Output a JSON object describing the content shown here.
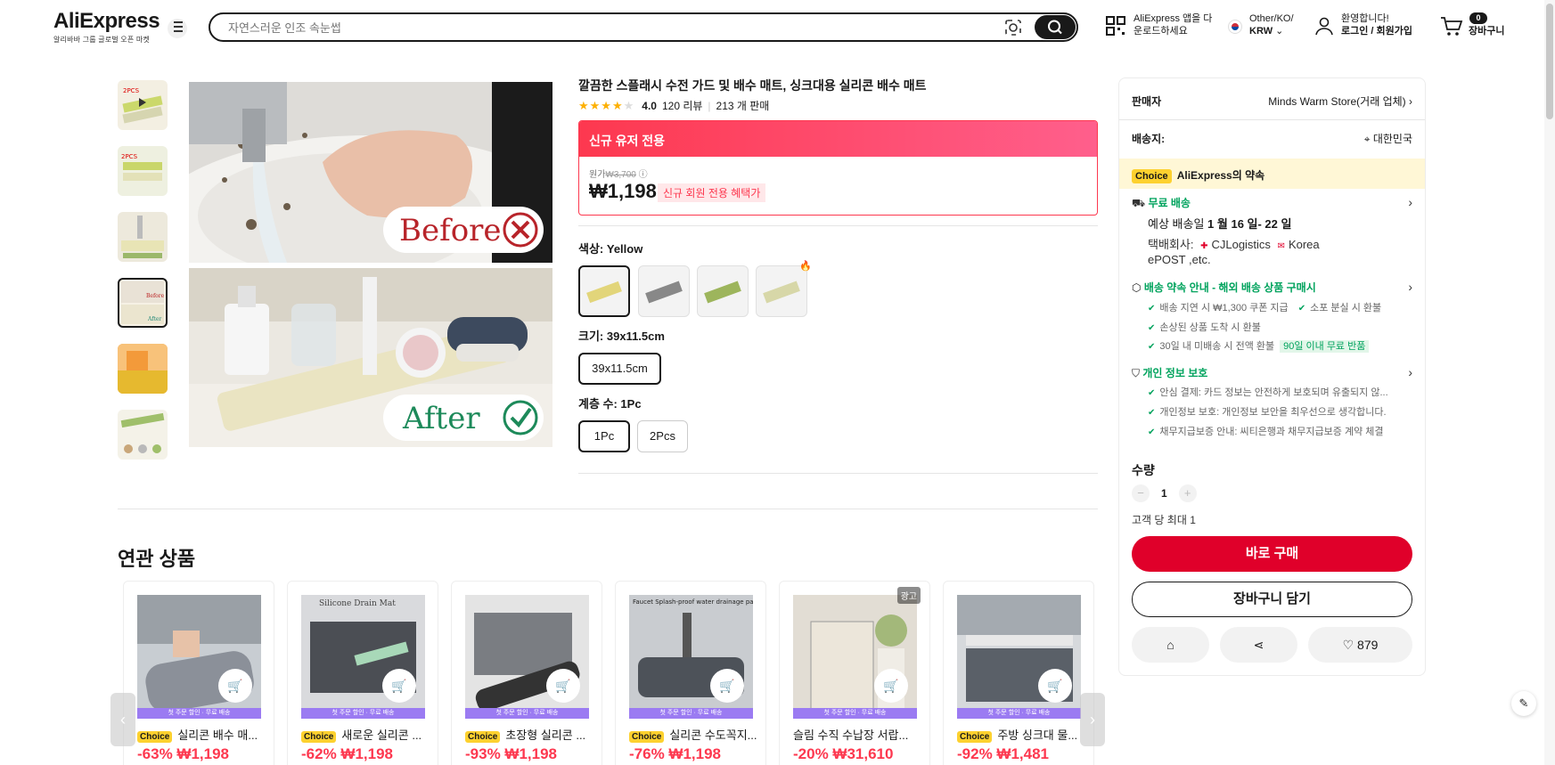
{
  "header": {
    "logo_text": "AliExpress",
    "logo_sub": "알리바바 그룹 글로벌 오픈 마켓",
    "search_placeholder": "자연스러운 인조 속눈썹",
    "app_line1": "AliExpress 앱을 다",
    "app_line2": "운로드하세요",
    "region_line1": "Other/KO/",
    "region_line2": "KRW",
    "account_line1": "환영합니다!",
    "account_line2": "로그인 / 회원가입",
    "cart_count": "0",
    "cart_label": "장바구니"
  },
  "product": {
    "title": "깔끔한 스플래시 수전 가드 및 배수 매트, 싱크대용 실리콘 배수 매트",
    "rating": "4.0",
    "reviews": "120 리뷰",
    "sold": "213 개 판매",
    "promo_header": "신규 유저 전용",
    "orig_label": "원가",
    "orig_price": "₩3,700",
    "price": "₩1,198",
    "price_badge": "신규 회원 전용 혜택가",
    "image_before_text": "Before",
    "image_after_text": "After",
    "color_label": "색상: Yellow",
    "size_label": "크기: 39x11.5cm",
    "size_options": [
      "39x11.5cm"
    ],
    "tier_label": "계층 수: 1Pc",
    "tier_options": [
      "1Pc",
      "2Pcs"
    ]
  },
  "panel": {
    "seller_label": "판매자",
    "seller_name": "Minds Warm Store(거래 업체)",
    "ship_label": "배송지:",
    "ship_to": "대한민국",
    "choice_tag": "Choice",
    "choice_text": "AliExpress의 약속",
    "free_ship": "무료 배송",
    "delivery_prefix": "예상 배송일",
    "delivery_date": "1 월 16 일- 22 일",
    "carrier_line1_prefix": "택배회사:",
    "carrier_line1_a": "CJLogistics",
    "carrier_line1_b": "Korea",
    "carrier_line2": "ePOST ,etc.",
    "promise_title": "배송 약속 안내 - 해외 배송 상품 구매시",
    "promise_1a": "배송 지연 시 ₩1,300 쿠폰 지급",
    "promise_1b": "소포 분실 시 환불",
    "promise_2": "손상된 상품 도착 시 환불",
    "promise_3": "30일 내 미배송 시 전액 환불",
    "promise_3_tag": "90일 이내 무료 반품",
    "privacy_title": "개인 정보 보호",
    "privacy_1": "안심 결제: 카드 정보는 안전하게 보호되며 유출되지 않...",
    "privacy_2": "개인정보 보호: 개인정보 보안을 최우선으로 생각합니다.",
    "privacy_3": "채무지급보증 안내: 씨티은행과 채무지급보증 계약 체결",
    "qty_label": "수량",
    "qty_value": "1",
    "qty_limit": "고객 당 최대 1",
    "buy_now": "바로 구매",
    "add_cart": "장바구니 담기",
    "wish_count": "879"
  },
  "related": {
    "title": "연관 상품",
    "band_text": "첫 주문 할인 · 무료 배송",
    "ad_label": "광고",
    "items": [
      {
        "choice": "Choice",
        "name": "실리콘 배수 매...",
        "price": "-63% ₩1,198"
      },
      {
        "choice": "Choice",
        "name": "새로운 실리콘 ...",
        "price": "-62% ₩1,198"
      },
      {
        "choice": "Choice",
        "name": "초장형 실리콘 ...",
        "price": "-93% ₩1,198"
      },
      {
        "choice": "Choice",
        "name": "실리콘 수도꼭지...",
        "price": "-76% ₩1,198"
      },
      {
        "choice": "",
        "name": "슬림 수직 수납장 서랍...",
        "price": "-20% ₩31,610"
      },
      {
        "choice": "Choice",
        "name": "주방 싱크대 물...",
        "price": "-92% ₩1,481"
      }
    ],
    "card2_img_text": "Silicone Drain Mat",
    "card4_img_text": "Faucet Splash-proof water drainage pad"
  },
  "colors": {
    "accent_red": "#fd384f",
    "buy_red": "#e0002a",
    "choice_yellow": "#fdd12f",
    "green": "#00a35d"
  }
}
